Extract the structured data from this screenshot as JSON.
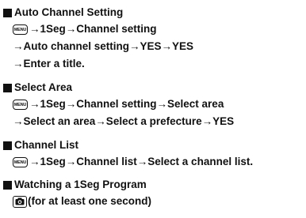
{
  "sections": [
    {
      "heading": "Auto Channel Setting",
      "lines": [
        {
          "key": "MENU",
          "text": "→1Seg→Channel setting"
        },
        {
          "text": "→Auto channel setting→YES→YES"
        },
        {
          "text": "→Enter a title."
        }
      ]
    },
    {
      "heading": "Select Area",
      "lines": [
        {
          "key": "MENU",
          "text": "→1Seg→Channel setting→Select area"
        },
        {
          "text": "→Select an area→Select a prefecture→YES"
        }
      ]
    },
    {
      "heading": "Channel List",
      "lines": [
        {
          "key": "MENU",
          "text": "→1Seg→Channel list→Select a channel list."
        }
      ]
    },
    {
      "heading": "Watching a 1Seg Program",
      "lines": [
        {
          "key": "camera-icon",
          "text": "(for at least one second)"
        }
      ]
    }
  ]
}
